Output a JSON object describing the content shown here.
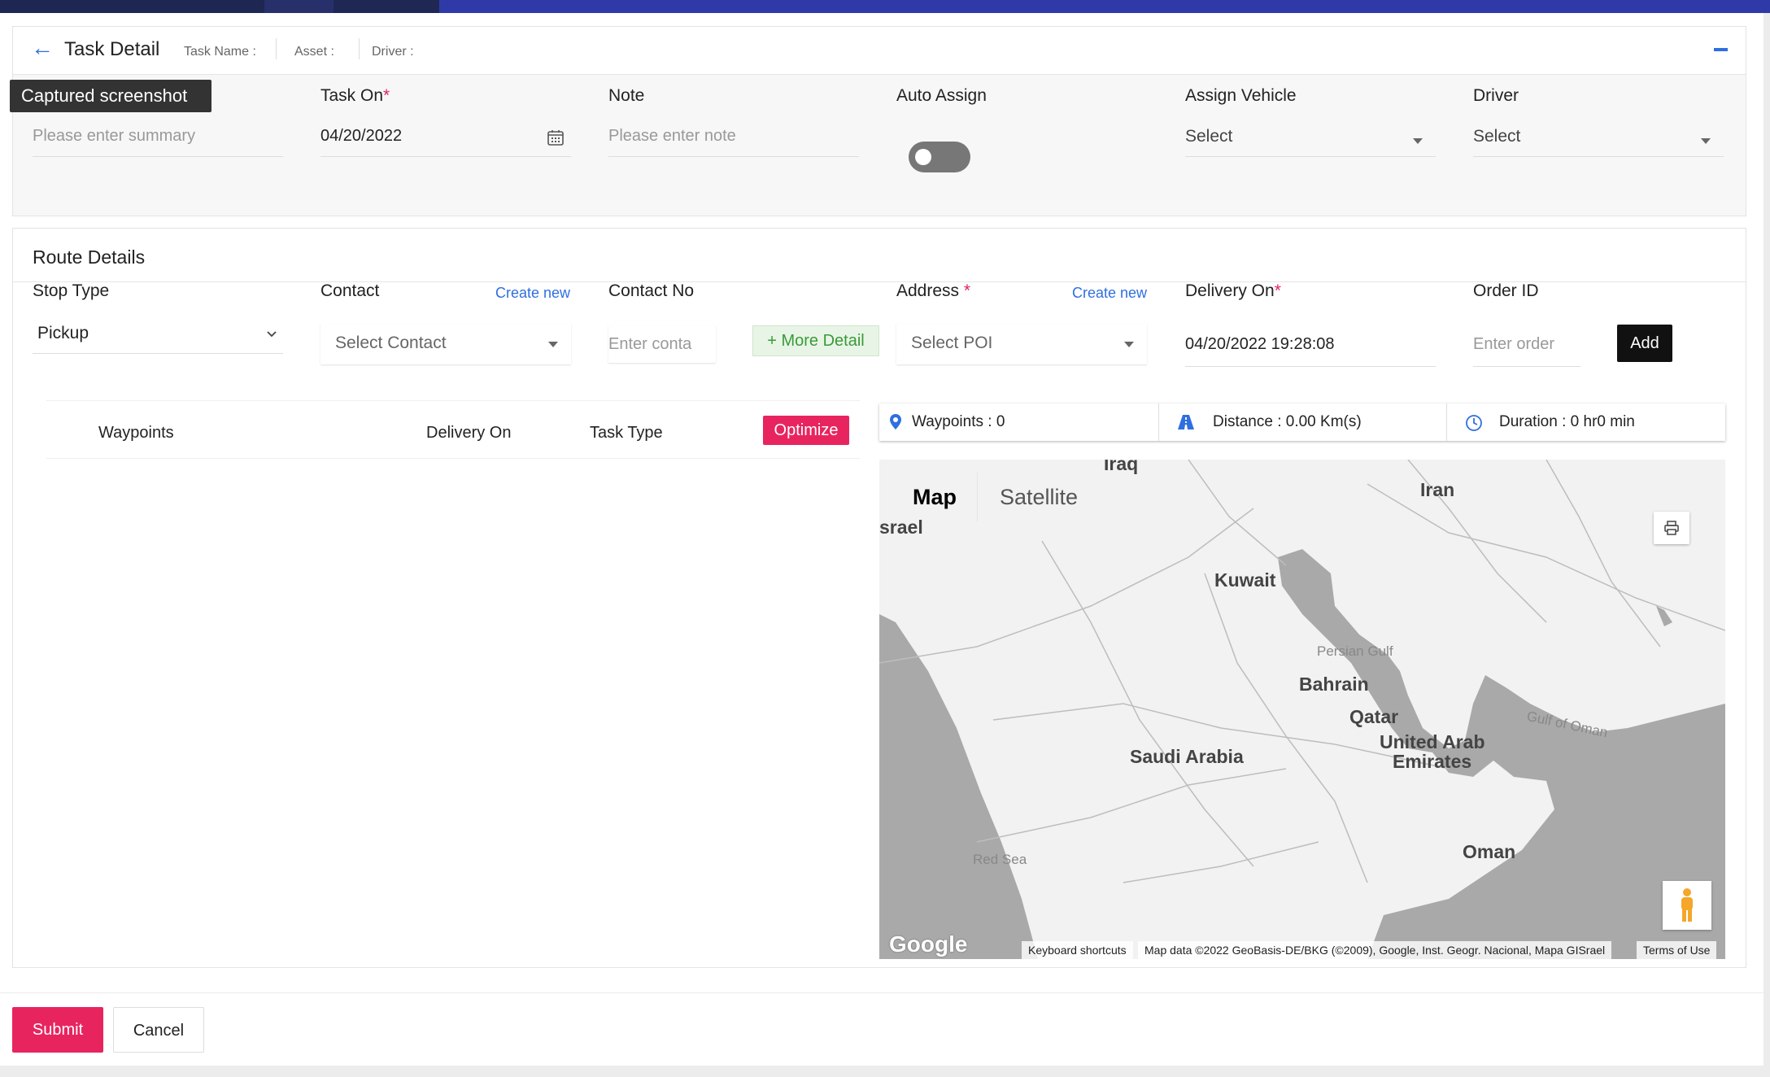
{
  "header": {
    "title": "Task Detail",
    "task_name_label": "Task Name :",
    "asset_label": "Asset :",
    "driver_label": "Driver :"
  },
  "tooltip": "Captured screenshot",
  "task_form": {
    "summary": {
      "placeholder": "Please enter summary"
    },
    "task_on": {
      "label": "Task On",
      "required_mark": "*",
      "value": "04/20/2022"
    },
    "note": {
      "label": "Note",
      "placeholder": "Please enter note"
    },
    "auto_assign": {
      "label": "Auto Assign",
      "on": false
    },
    "assign_vehicle": {
      "label": "Assign Vehicle",
      "value": "Select"
    },
    "driver": {
      "label": "Driver",
      "value": "Select"
    }
  },
  "route": {
    "title": "Route Details",
    "stop_type": {
      "label": "Stop Type",
      "value": "Pickup"
    },
    "contact": {
      "label": "Contact",
      "create_new": "Create new",
      "value": "Select Contact"
    },
    "contact_no": {
      "label": "Contact No",
      "placeholder": "Enter conta"
    },
    "more_detail": "+ More Detail",
    "address": {
      "label": "Address",
      "required_mark": "*",
      "create_new": "Create new",
      "value": "Select POI"
    },
    "delivery_on": {
      "label": "Delivery On",
      "required_mark": "*",
      "value": "04/20/2022 19:28:08"
    },
    "order_id": {
      "label": "Order ID",
      "placeholder": "Enter order"
    },
    "add_button": "Add"
  },
  "waypoints_table": {
    "columns": [
      "Waypoints",
      "Delivery On",
      "Task Type"
    ],
    "optimize_button": "Optimize"
  },
  "stats": {
    "waypoints": "Waypoints : 0",
    "distance": "Distance : 0.00 Km(s)",
    "duration": "Duration : 0 hr0 min"
  },
  "map": {
    "tabs": [
      "Map",
      "Satellite"
    ],
    "active_tab": "Map",
    "labels": [
      "Iraq",
      "Iran",
      "srael",
      "Kuwait",
      "Bahrain",
      "Qatar",
      "United Arab",
      "Emirates",
      "Saudi Arabia",
      "Oman"
    ],
    "sea_labels": [
      "Persian Gulf",
      "Gulf of Oman",
      "Red Sea"
    ],
    "logo": "Google",
    "attribution": [
      "Keyboard shortcuts",
      "Map data ©2022 GeoBasis-DE/BKG (©2009), Google, Inst. Geogr. Nacional, Mapa GISrael",
      "Terms of Use"
    ]
  },
  "footer": {
    "submit": "Submit",
    "cancel": "Cancel"
  },
  "colors": {
    "accent": "#2f6fe0",
    "primary_button": "#e8245f",
    "topbar": "#2f3aa8"
  }
}
